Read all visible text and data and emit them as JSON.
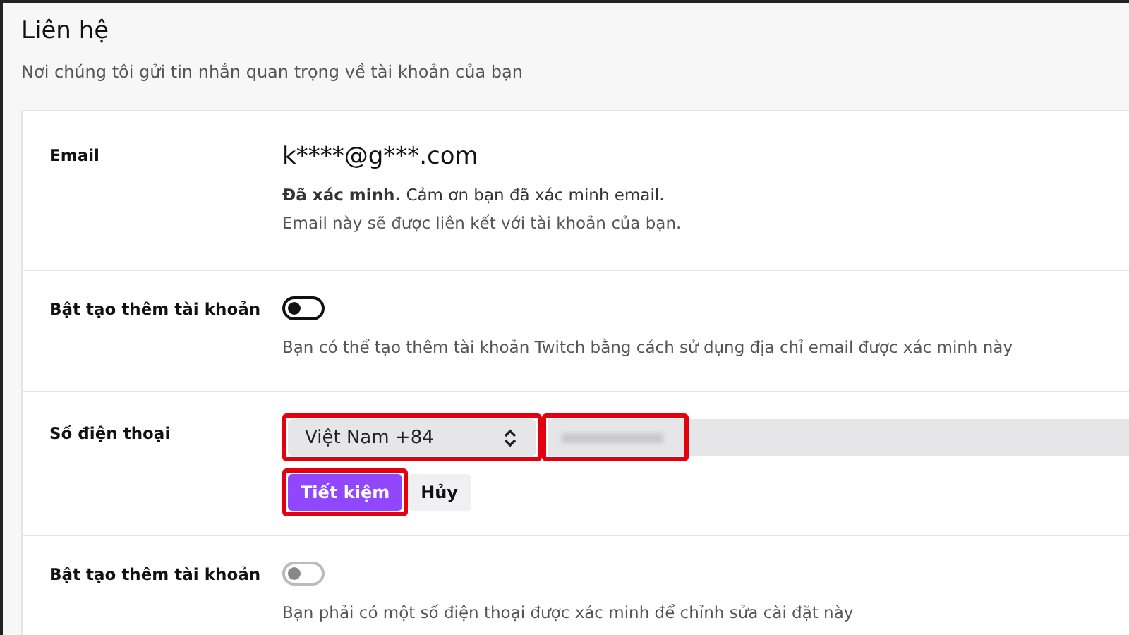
{
  "section": {
    "title": "Liên hệ",
    "subtitle": "Nơi chúng tôi gửi tin nhắn quan trọng về tài khoản của bạn"
  },
  "rows": [
    {
      "kind": "email",
      "label": "Email",
      "value": "k****@g***.com",
      "note": "**Đã xác minh.** Cảm ơn bạn đã xác minh email.",
      "description": "Email này sẽ được liên kết với tài khoản của bạn."
    },
    {
      "kind": "toggle",
      "label": "Bật tạo thêm tài khoản",
      "on": false,
      "disabled": false,
      "description": "Bạn có thể tạo thêm tài khoản Twitch bằng cách sử dụng địa chỉ email được xác minh này"
    },
    {
      "kind": "phone",
      "label": "Số điện thoại",
      "country": {
        "value": "Việt Nam +84",
        "highlighted": true
      },
      "number": {
        "highlighted": true
      },
      "buttons": [
        {
          "label": "Tiết kiệm",
          "kind": "primary",
          "highlighted": true
        },
        {
          "label": "Hủy",
          "kind": "secondary",
          "highlighted": false
        }
      ]
    },
    {
      "kind": "toggle",
      "label": "Bật tạo thêm tài khoản",
      "on": false,
      "disabled": true,
      "description": "Bạn phải có một số điện thoại được xác minh để chỉnh sửa cài đặt này"
    }
  ]
}
